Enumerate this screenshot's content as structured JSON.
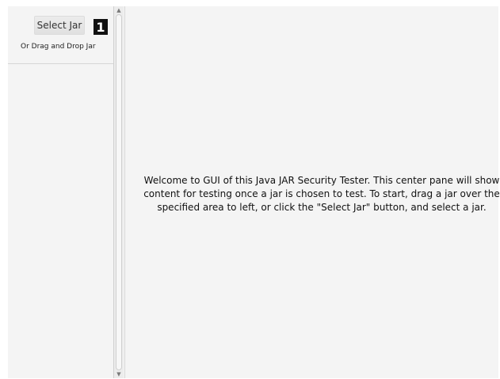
{
  "left_pane": {
    "select_button_label": "Select Jar",
    "callout_number": "1",
    "drop_label": "Or Drag and Drop Jar"
  },
  "center_pane": {
    "welcome_text": "Welcome to GUI of this Java JAR Security Tester. This center pane will show\ncontent for testing once a jar is chosen to test. To start, drag a jar over the\nspecified area to left, or click the \"Select Jar\" button, and select a jar."
  },
  "icons": {
    "scroll_up": "scroll-up-arrow-icon",
    "scroll_down": "scroll-down-arrow-icon"
  }
}
